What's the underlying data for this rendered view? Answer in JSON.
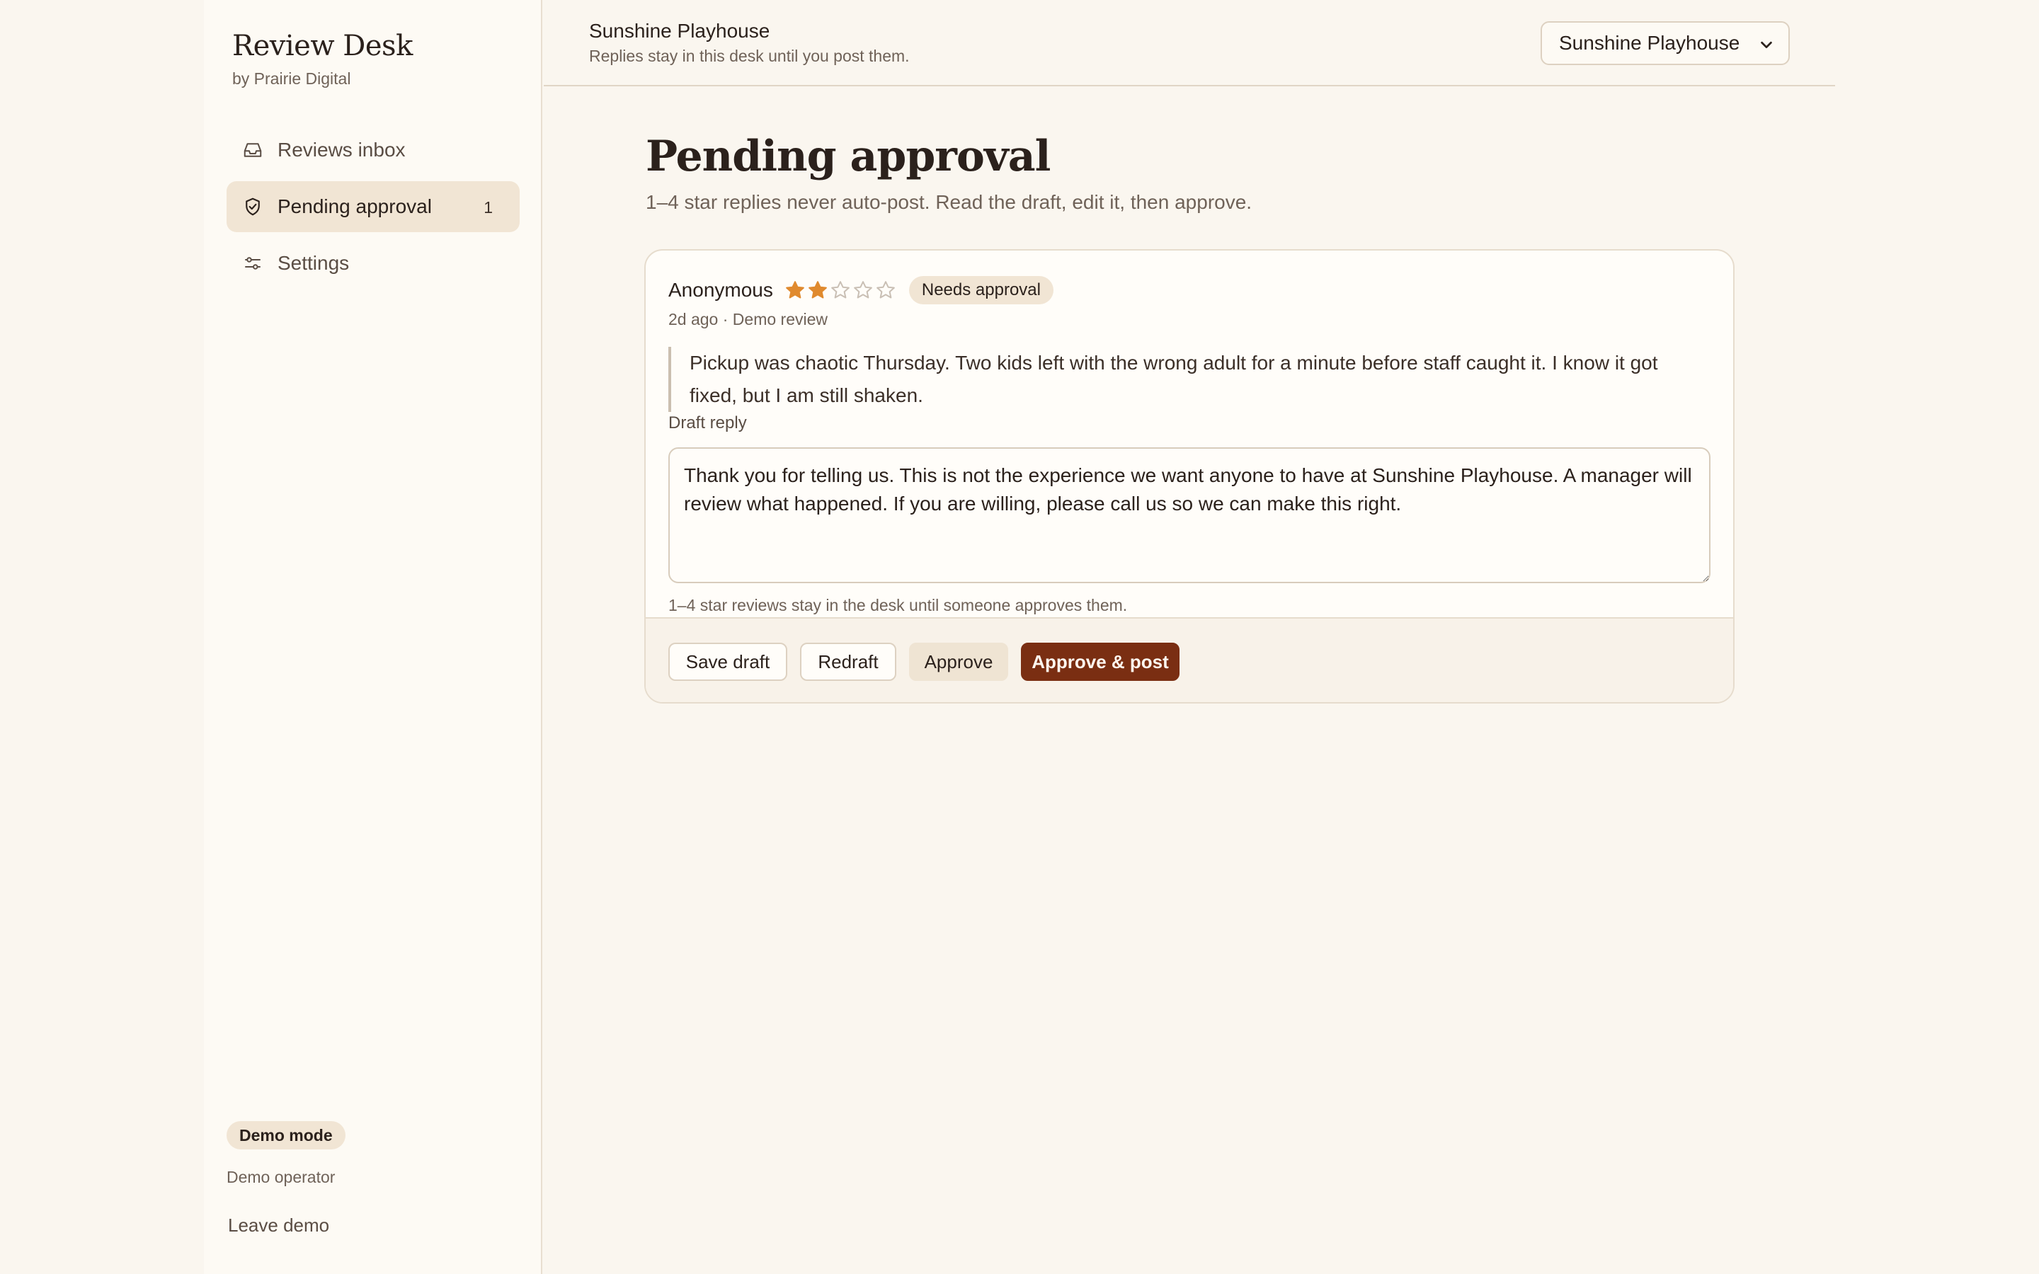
{
  "brand": {
    "title": "Review Desk",
    "subtitle": "by Prairie Digital"
  },
  "sidebar": {
    "items": [
      {
        "label": "Reviews inbox",
        "icon": "inbox-icon"
      },
      {
        "label": "Pending approval",
        "icon": "shield-check-icon",
        "count": "1",
        "active": true
      },
      {
        "label": "Settings",
        "icon": "sliders-icon"
      }
    ],
    "demo_badge": "Demo mode",
    "operator": "Demo operator",
    "leave_label": "Leave demo"
  },
  "topbar": {
    "location_name": "Sunshine Playhouse",
    "location_note": "Replies stay in this desk until you post them.",
    "location_select": "Sunshine Playhouse"
  },
  "main": {
    "title": "Pending approval",
    "subtitle": "1–4 star replies never auto-post. Read the draft, edit it, then approve."
  },
  "review": {
    "author": "Anonymous",
    "rating": 2,
    "rating_max": 5,
    "status_badge": "Needs approval",
    "meta": "2d ago · Demo review",
    "text": "Pickup was chaotic Thursday. Two kids left with the wrong adult for a minute before staff caught it. I know it got fixed, but I am still shaken.",
    "draft_label": "Draft reply",
    "draft_text": "Thank you for telling us. This is not the experience we want anyone to have at Sunshine Playhouse. A manager will review what happened. If you are willing, please call us so we can make this right.",
    "policy_note": "1–4 star reviews stay in the desk until someone approves them.",
    "actions": {
      "save_draft": "Save draft",
      "redraft": "Redraft",
      "approve": "Approve",
      "approve_post": "Approve & post"
    }
  },
  "colors": {
    "background": "#faf6ef",
    "sidebar": "#fdfaf4",
    "active_nav": "#f1e5d4",
    "accent": "#7a2e12",
    "star_filled": "#e08a2e",
    "star_empty": "#c9bfb4"
  }
}
